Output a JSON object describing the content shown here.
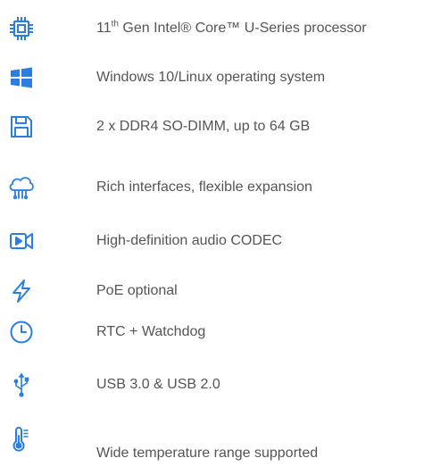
{
  "accent_color": "#2a7de1",
  "text_color": "#555555",
  "features": [
    {
      "icon": "cpu-icon",
      "text_prefix": "11",
      "text_sup": "th",
      "text_suffix": " Gen Intel® Core™ U-Series processor"
    },
    {
      "icon": "windows-logo-icon",
      "text": "Windows 10/Linux operating system"
    },
    {
      "icon": "floppy-disk-icon",
      "text": "2 x DDR4 SO-DIMM, up to 64 GB"
    },
    {
      "icon": "cloud-network-icon",
      "text": "Rich interfaces, flexible expansion"
    },
    {
      "icon": "video-camera-icon",
      "text": "High-definition audio CODEC"
    },
    {
      "icon": "lightning-bolt-icon",
      "text": "PoE optional"
    },
    {
      "icon": "clock-icon",
      "text": "RTC + Watchdog"
    },
    {
      "icon": "usb-icon",
      "text": "USB 3.0 & USB 2.0"
    },
    {
      "icon": "thermometer-icon",
      "text": "Wide temperature range supported"
    }
  ]
}
